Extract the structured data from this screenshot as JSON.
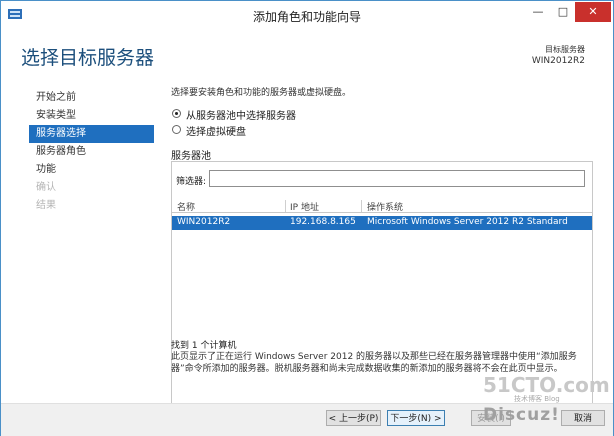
{
  "window": {
    "title": "添加角色和功能向导"
  },
  "header": {
    "page_title": "选择目标服务器",
    "target_label": "目标服务器",
    "target_name": "WIN2012R2"
  },
  "nav": {
    "items": [
      {
        "label": "开始之前",
        "state": "normal"
      },
      {
        "label": "安装类型",
        "state": "normal"
      },
      {
        "label": "服务器选择",
        "state": "active"
      },
      {
        "label": "服务器角色",
        "state": "normal"
      },
      {
        "label": "功能",
        "state": "normal"
      },
      {
        "label": "确认",
        "state": "disabled"
      },
      {
        "label": "结果",
        "state": "disabled"
      }
    ]
  },
  "content": {
    "instruction": "选择要安装角色和功能的服务器或虚拟硬盘。",
    "option_pool": "从服务器池中选择服务器",
    "option_vhd": "选择虚拟硬盘",
    "pool_heading": "服务器池",
    "filter_label": "筛选器:",
    "filter_value": "",
    "columns": [
      "名称",
      "IP 地址",
      "操作系统"
    ],
    "rows": [
      {
        "name": "WIN2012R2",
        "ip": "192.168.8.165",
        "os": "Microsoft Windows Server 2012 R2 Standard"
      }
    ],
    "found_text": "找到 1 个计算机",
    "description": "此页显示了正在运行 Windows Server 2012 的服务器以及那些已经在服务器管理器中使用“添加服务器”命令所添加的服务器。脱机服务器和尚未完成数据收集的新添加的服务器将不会在此页中显示。"
  },
  "footer": {
    "prev": "< 上一步(P)",
    "next": "下一步(N) >",
    "install": "安装(I)",
    "cancel": "取消"
  },
  "watermark": {
    "line1": "51CTO.com",
    "line2": "技术博客 Blog",
    "line3": "Discuz!"
  },
  "colors": {
    "accent": "#1f6fbf",
    "title": "#1c4f7c",
    "close": "#c9302c"
  }
}
